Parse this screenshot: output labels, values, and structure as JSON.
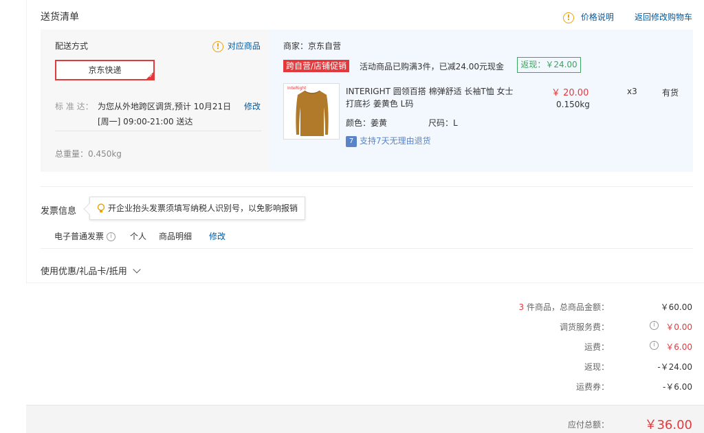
{
  "header": {
    "title": "送货清单",
    "price_info": "价格说明",
    "back_to_cart": "返回修改购物车"
  },
  "shipping": {
    "method_label": "配送方式",
    "match_goods": "对应商品",
    "method_value": "京东快递",
    "standard_label": "标 准 达：",
    "standard_line1": "为您从外地跨区调货,预计 10月21日",
    "standard_line2": "[周一] 09:00-21:00 送达",
    "modify": "修改",
    "weight": "总重量：0.450kg"
  },
  "merchant": {
    "name": "商家：京东自营",
    "promo_tag": "跨自营/店铺促销",
    "promo_text": "活动商品已购满3件，已减24.00元现金",
    "cashback": "返现：￥24.00"
  },
  "product": {
    "thumb_brand": "InteRight",
    "title_line1": "INTERIGHT 圆领百搭 棉弹舒适 长袖T恤 女士",
    "title_line2": "打底衫 姜黄色 L码",
    "price": "￥ 20.00",
    "weight": "0.150kg",
    "quantity": "x3",
    "stock": "有货",
    "color": "颜色：姜黄",
    "size": "尺码：L",
    "return_policy": "支持7天无理由退货",
    "return_icon": "7"
  },
  "invoice": {
    "title": "发票信息",
    "hint": "开企业抬头发票须填写纳税人识别号，以免影响报销",
    "type": "电子普通发票",
    "person": "个人",
    "content": "商品明细",
    "modify": "修改"
  },
  "coupon": {
    "label": "使用优惠/礼品卡/抵用"
  },
  "summary": {
    "count": "3",
    "count_label": " 件商品，总商品金额：",
    "goods_total": "￥60.00",
    "transfer_fee_label": "调货服务费：",
    "transfer_fee": "￥0.00",
    "freight_label": "运费：",
    "freight": "￥6.00",
    "cashback_label": "返现：",
    "cashback": "-￥24.00",
    "freight_coupon_label": "运费券：",
    "freight_coupon": "-￥6.00",
    "payable_label": "应付总额：",
    "payable": "￥36.00"
  },
  "colors": {
    "accent_red": "#e4393c",
    "link_blue": "#005aa0",
    "cashback_green": "#3ba55c",
    "warn_orange": "#f0a000"
  }
}
